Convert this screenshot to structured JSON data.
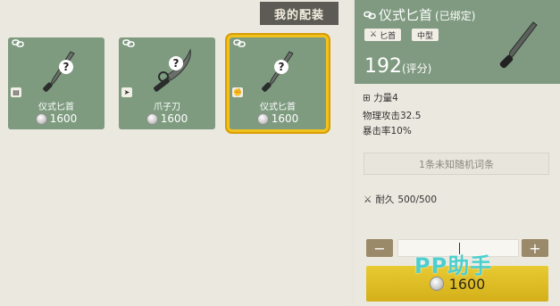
{
  "tab": {
    "label": "我的配装"
  },
  "cards": [
    {
      "name": "仪式匕首",
      "price": "1600",
      "corner_icon": "book-icon",
      "selected": false
    },
    {
      "name": "爪子刀",
      "price": "1600",
      "corner_icon": "tag-icon",
      "selected": false
    },
    {
      "name": "仪式匕首",
      "price": "1600",
      "corner_icon": "fist-icon",
      "selected": true
    }
  ],
  "detail": {
    "title": "仪式匕首",
    "bound": "(已绑定)",
    "tags": [
      "匕首",
      "中型"
    ],
    "score": "192",
    "score_label": "(评分)",
    "stats": [
      "力量4",
      "物理攻击32.5",
      "暴击率10%"
    ],
    "random_slot": "1条未知随机词条",
    "durability_label": "耐久",
    "durability_value": "500/500",
    "qty_minus": "−",
    "qty_plus": "+",
    "buy_price": "1600"
  },
  "watermark": "PP助手",
  "colors": {
    "card_bg": "#7e9b80",
    "selected_border": "#f1c21b",
    "buy_button": "#d9b620",
    "watermark": "#4ecfcf"
  }
}
